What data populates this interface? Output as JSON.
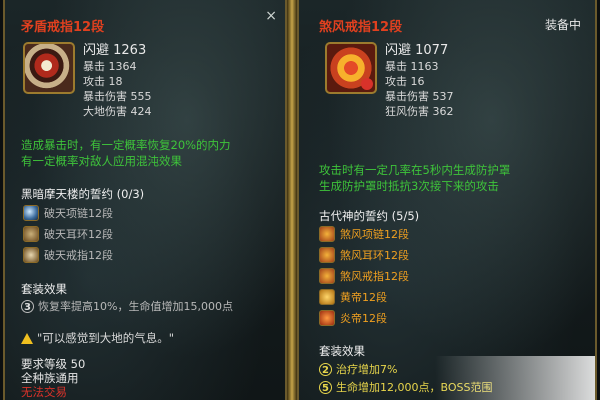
{
  "left": {
    "title": "矛盾戒指12段",
    "close_icon": "×",
    "stats": [
      "闪避 1263",
      "暴击 1364",
      "攻击 18",
      "暴击伤害 555",
      "大地伤害 424"
    ],
    "effects": [
      "造成暴击时，有一定概率恢复20%的内力",
      "有一定概率对敌人应用混沌效果"
    ],
    "set_title": "黑暗摩天楼的誓约 (0/3)",
    "set_items": [
      "破天项链12段",
      "破天耳环12段",
      "破天戒指12段"
    ],
    "bonus_label": "套装效果",
    "bonus_lines": [
      {
        "num": "3",
        "text": "恢复率提高10%，生命值增加15,000点"
      }
    ],
    "quote": "\"可以感觉到大地的气息。\"",
    "requirements": [
      "要求等级 50",
      "全种族通用",
      "无法交易"
    ]
  },
  "right": {
    "title": "煞风戒指12段",
    "equipped": "装备中",
    "stats": [
      "闪避 1077",
      "暴击 1163",
      "攻击 16",
      "暴击伤害 537",
      "狂风伤害 362"
    ],
    "effects": [
      "攻击时有一定几率在5秒内生成防护罩",
      "生成防护罩时抵抗3次接下来的攻击"
    ],
    "set_title": "古代神的誓约 (5/5)",
    "set_items": [
      "煞风项链12段",
      "煞风耳环12段",
      "煞风戒指12段",
      "黄帝12段",
      "炎帝12段"
    ],
    "bonus_label": "套装效果",
    "bonus_lines": [
      {
        "num": "2",
        "text": "治疗增加7%"
      },
      {
        "num": "5",
        "text": "生命增加12,000点，BOSS范围"
      }
    ]
  }
}
